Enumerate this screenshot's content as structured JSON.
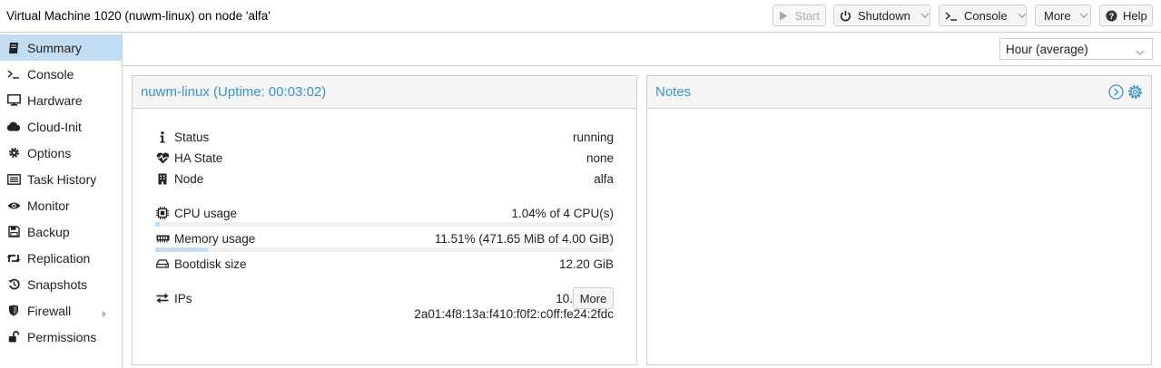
{
  "header": {
    "title": "Virtual Machine 1020 (nuwm-linux) on node 'alfa'",
    "buttons": {
      "start": "Start",
      "shutdown": "Shutdown",
      "console": "Console",
      "more": "More",
      "help": "Help"
    }
  },
  "sidebar": {
    "items": [
      {
        "label": "Summary",
        "icon": "book-icon"
      },
      {
        "label": "Console",
        "icon": "terminal-icon"
      },
      {
        "label": "Hardware",
        "icon": "desktop-icon"
      },
      {
        "label": "Cloud-Init",
        "icon": "cloud-icon"
      },
      {
        "label": "Options",
        "icon": "gear-icon"
      },
      {
        "label": "Task History",
        "icon": "list-icon"
      },
      {
        "label": "Monitor",
        "icon": "eye-icon"
      },
      {
        "label": "Backup",
        "icon": "floppy-icon"
      },
      {
        "label": "Replication",
        "icon": "retweet-icon"
      },
      {
        "label": "Snapshots",
        "icon": "history-icon"
      },
      {
        "label": "Firewall",
        "icon": "shield-icon"
      },
      {
        "label": "Permissions",
        "icon": "unlock-icon"
      }
    ],
    "active_index": 0
  },
  "timeframe": {
    "selected": "Hour (average)"
  },
  "status_panel": {
    "title": "nuwm-linux (Uptime: 00:03:02)",
    "status_label": "Status",
    "status_value": "running",
    "ha_label": "HA State",
    "ha_value": "none",
    "node_label": "Node",
    "node_value": "alfa",
    "cpu_label": "CPU usage",
    "cpu_value": "1.04% of 4 CPU(s)",
    "cpu_fraction": 0.0104,
    "mem_label": "Memory usage",
    "mem_value": "11.51% (471.65 MiB of 4.00 GiB)",
    "mem_fraction": 0.1151,
    "disk_label": "Bootdisk size",
    "disk_value": "12.20 GiB",
    "ips_label": "IPs",
    "ip1": "10.0.10.20",
    "ip2": "2a01:4f8:13a:f410:f0f2:c0ff:fe24:2fdc",
    "more_label": "More"
  },
  "notes_panel": {
    "title": "Notes"
  },
  "colors": {
    "accent": "#3892d4",
    "active_bg": "#c2ddf2",
    "border": "#cfcfcf"
  }
}
